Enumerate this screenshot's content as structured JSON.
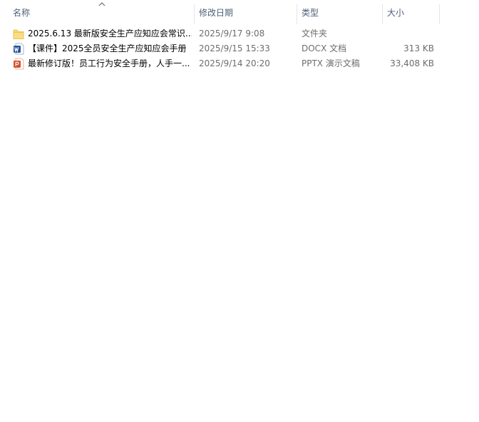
{
  "columns": {
    "name": "名称",
    "date": "修改日期",
    "type": "类型",
    "size": "大小"
  },
  "rows": [
    {
      "icon": "folder-icon",
      "name": "2025.6.13 最新版安全生产应知应会常识...",
      "date": "2025/9/17 9:08",
      "type": "文件夹",
      "size": ""
    },
    {
      "icon": "word-document-icon",
      "name": "【课件】2025全员安全生产应知应会手册",
      "date": "2025/9/15 15:33",
      "type": "DOCX 文档",
      "size": "313 KB"
    },
    {
      "icon": "powerpoint-document-icon",
      "name": "最新修订版！员工行为安全手册，人手一...",
      "date": "2025/9/14 20:20",
      "type": "PPTX 演示文稿",
      "size": "33,408 KB"
    }
  ],
  "colors": {
    "header_text": "#4c607a",
    "secondary_text": "#6d6d6d",
    "folder": "#f8d775",
    "word": "#2b5797",
    "powerpoint": "#d35230"
  }
}
